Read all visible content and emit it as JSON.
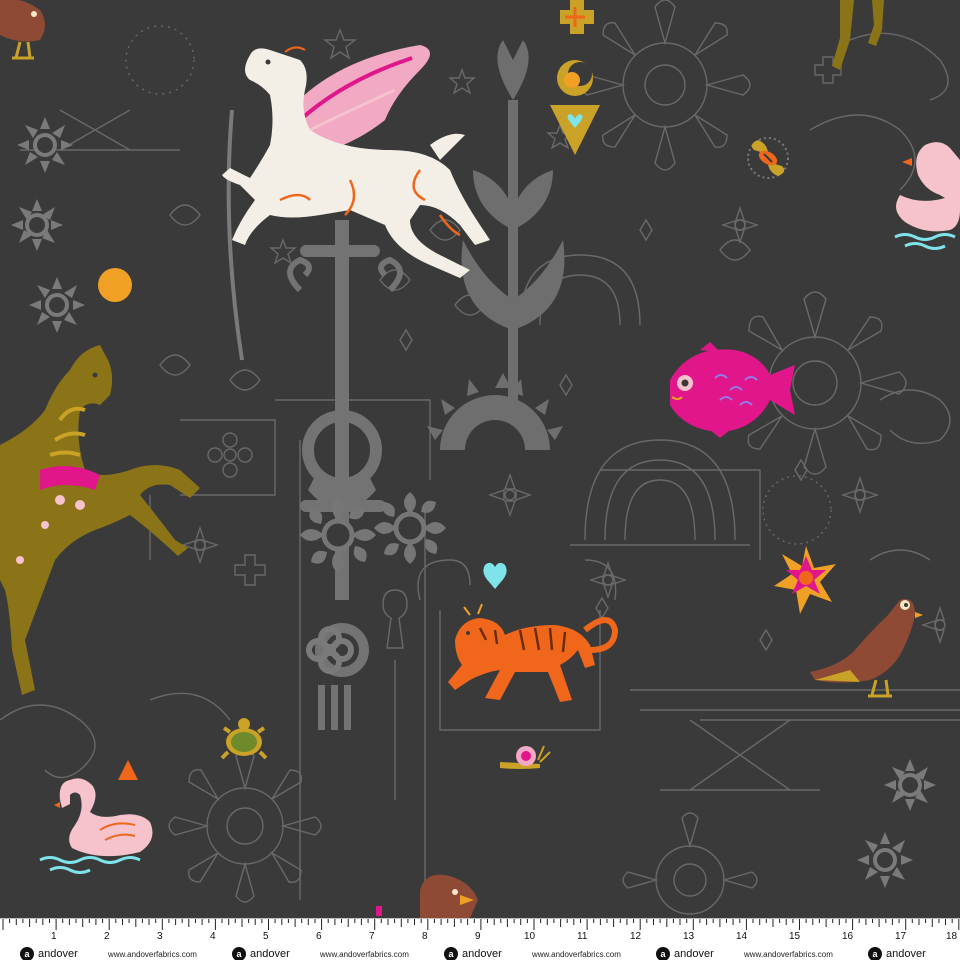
{
  "ruler": {
    "numbers": [
      "1",
      "2",
      "3",
      "4",
      "5",
      "6",
      "7",
      "8",
      "9",
      "10",
      "11",
      "12",
      "13",
      "14",
      "15",
      "16",
      "17",
      "18"
    ],
    "brand_name": "andover",
    "brand_mark": "a",
    "website": "www.andoverfabrics.com"
  },
  "colors": {
    "background": "#3b3a3a",
    "line_art": "#6b6a6a",
    "solid_grey": "#7a7979",
    "horse_olive": "#8a7417",
    "pegasus_white": "#f3efe6",
    "wing_pink": "#f2a9c4",
    "fish_magenta": "#e0168a",
    "tiger_orange": "#f0671c",
    "swan_pink": "#f6c2cc",
    "pigeon_brown": "#8e4a35",
    "gold": "#c9a227",
    "sun_orange": "#f0a025",
    "water_cyan": "#7fe3ea"
  },
  "motifs": [
    "pegasus",
    "rearing-horse",
    "swan",
    "swan",
    "tiger",
    "fish",
    "pigeon",
    "turtle",
    "snail",
    "bird",
    "bee",
    "star-burst",
    "sun-dot",
    "heart",
    "triangle"
  ]
}
